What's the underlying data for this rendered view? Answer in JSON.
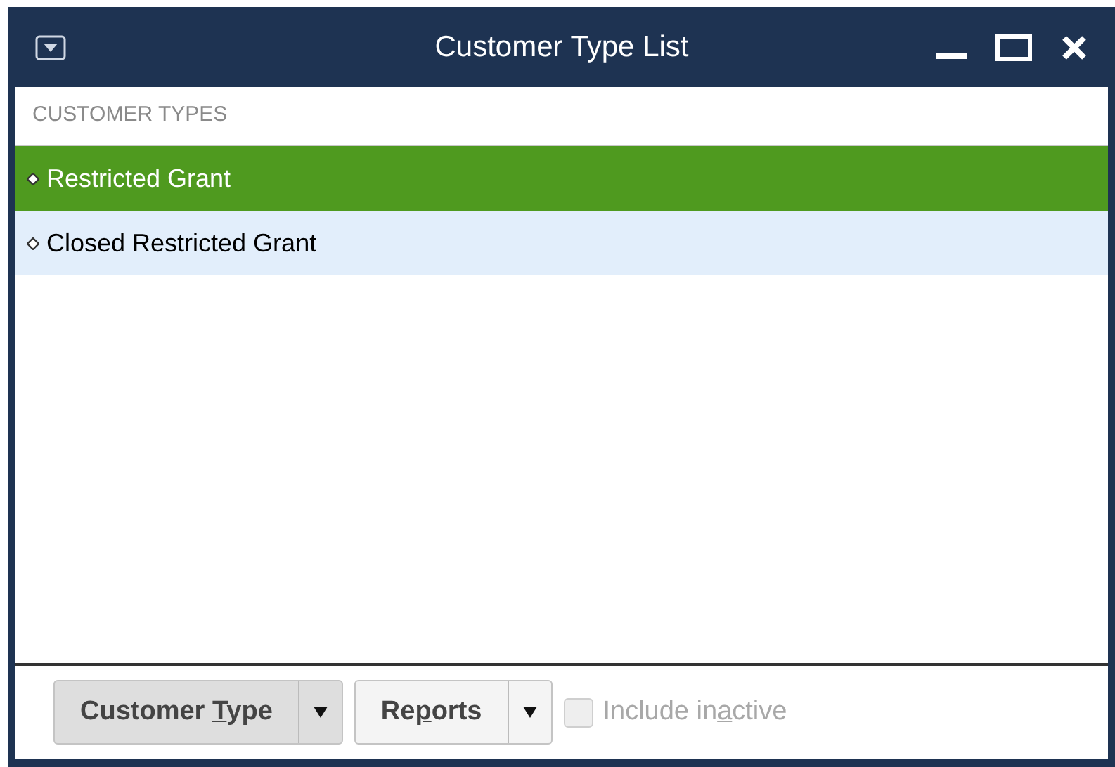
{
  "window": {
    "title": "Customer Type List"
  },
  "list": {
    "header": "CUSTOMER TYPES",
    "rows": [
      {
        "label": "Restricted Grant",
        "selected": true
      },
      {
        "label": "Closed Restricted Grant",
        "selected": false
      }
    ]
  },
  "toolbar": {
    "buttons": [
      {
        "before": "Customer ",
        "key": "T",
        "after": "ype"
      },
      {
        "before": "Re",
        "key": "p",
        "after": "orts"
      }
    ],
    "checkbox": {
      "before": "Include in",
      "key": "a",
      "after": "ctive",
      "checked": false,
      "disabled": true
    }
  }
}
